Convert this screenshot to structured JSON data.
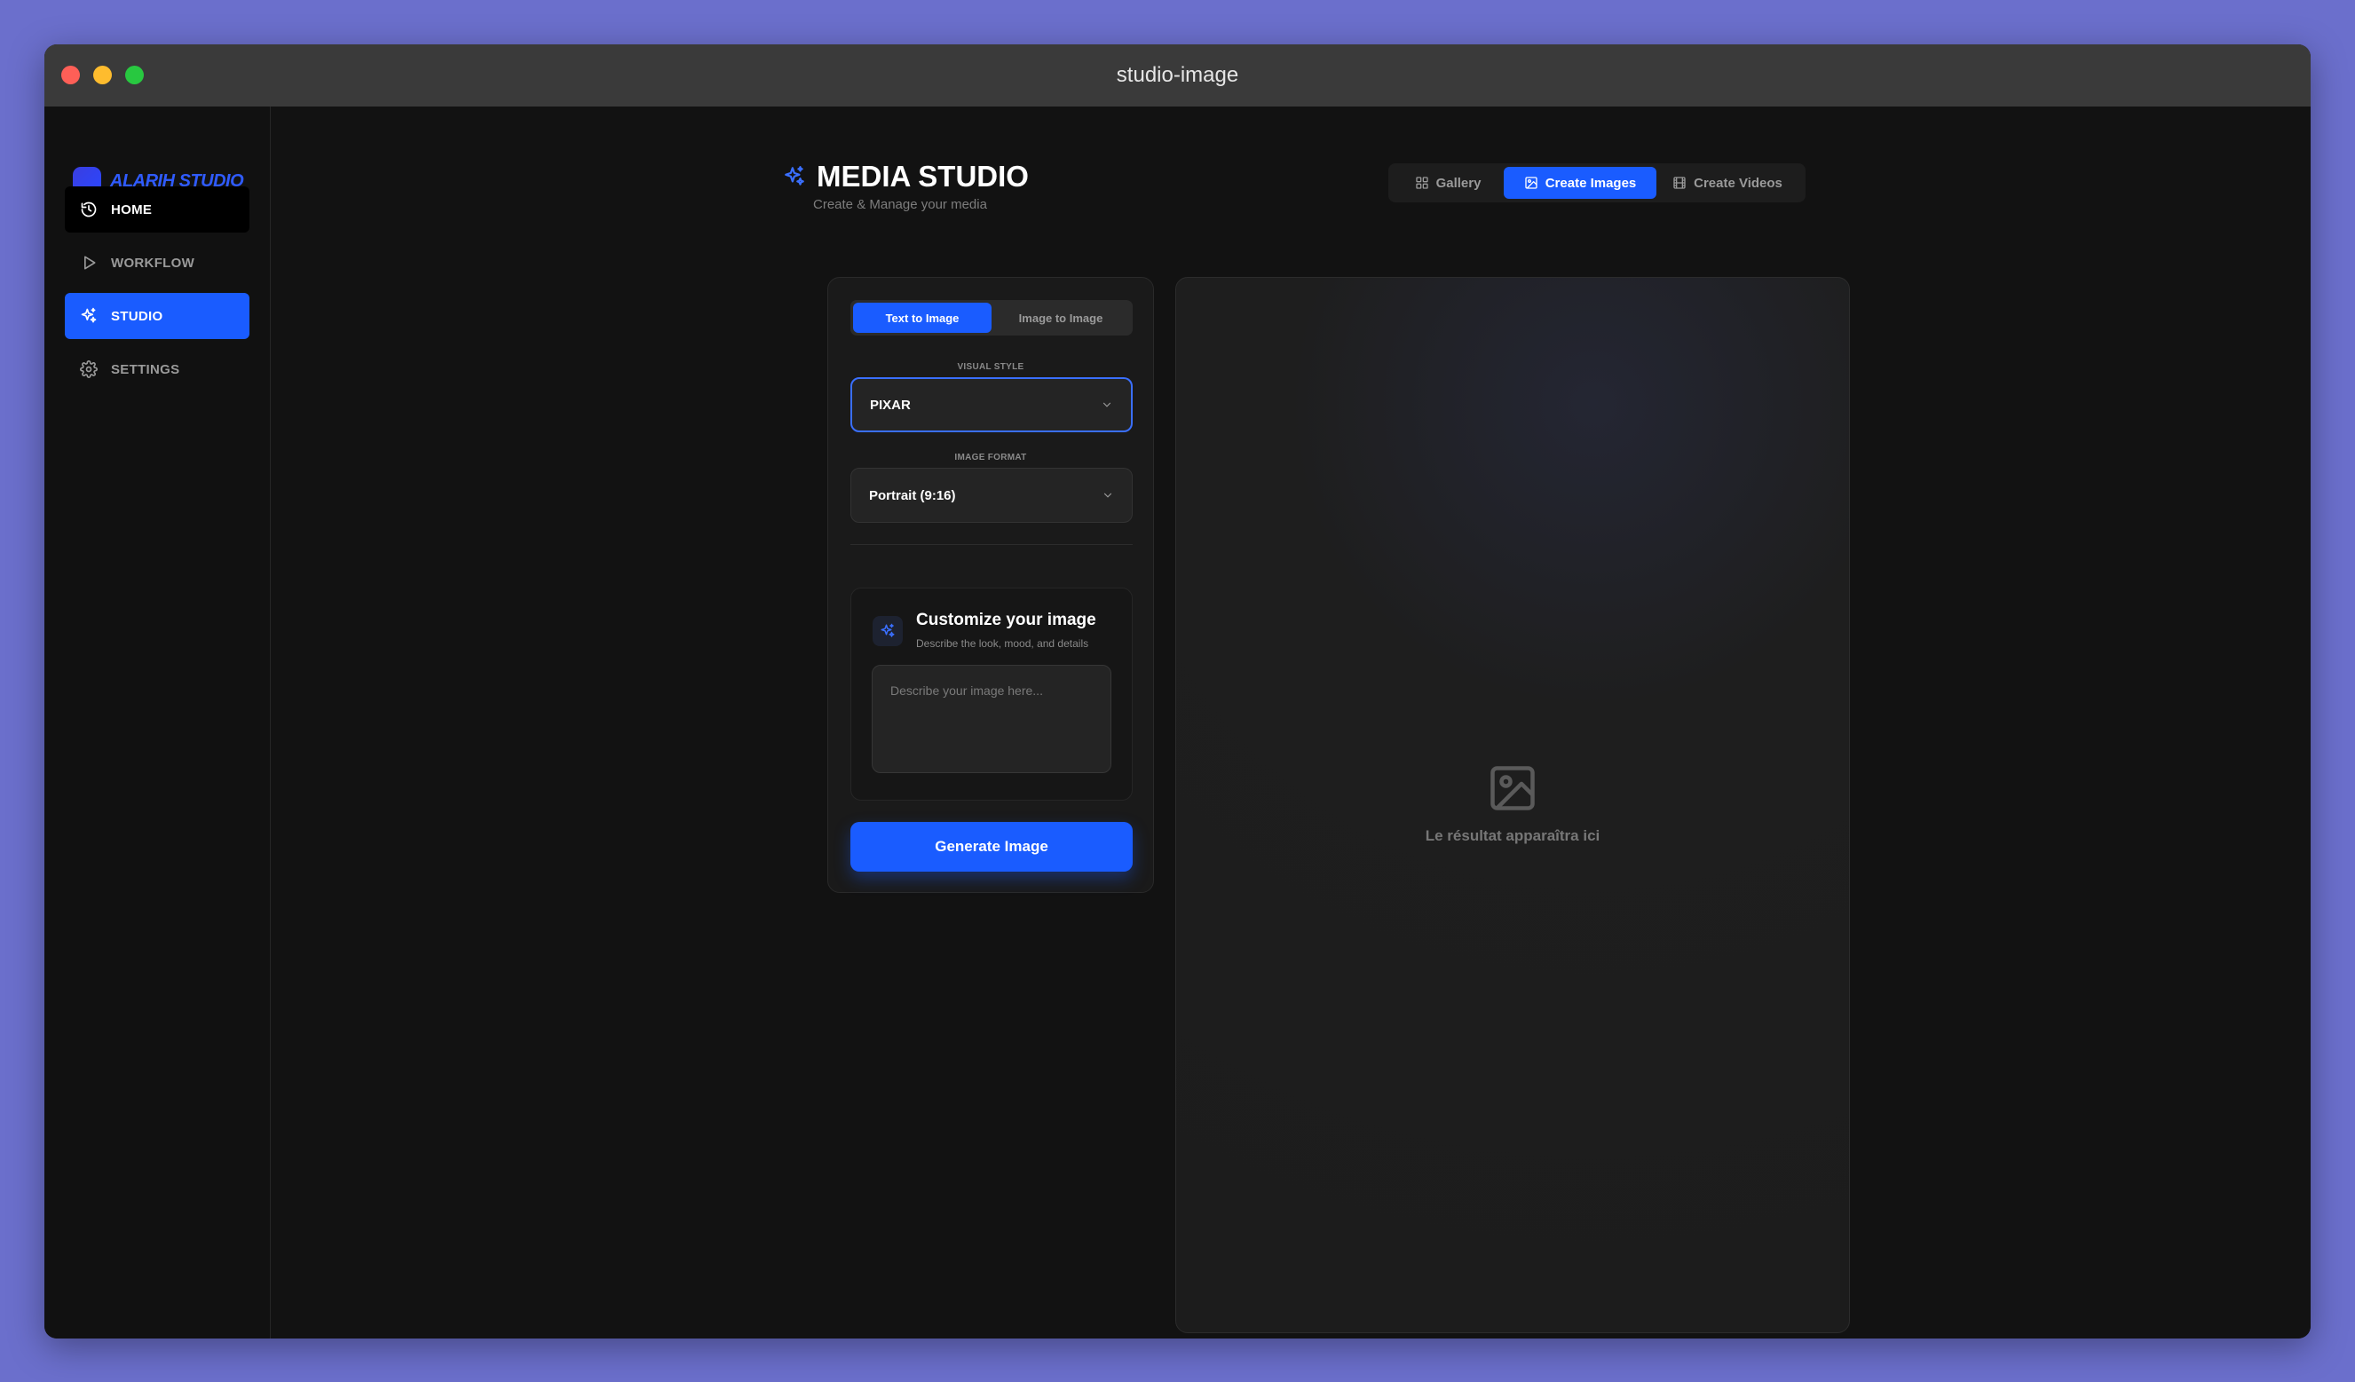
{
  "window": {
    "title": "studio-image"
  },
  "sidebar": {
    "brand": "ALARIH STUDIO",
    "items": [
      {
        "label": "HOME",
        "icon": "history-icon"
      },
      {
        "label": "WORKFLOW",
        "icon": "play-icon"
      },
      {
        "label": "STUDIO",
        "icon": "sparkles-icon"
      },
      {
        "label": "SETTINGS",
        "icon": "gear-icon"
      }
    ]
  },
  "header": {
    "title": "MEDIA STUDIO",
    "subtitle": "Create & Manage your media"
  },
  "top_tabs": [
    {
      "label": "Gallery",
      "icon": "grid-icon"
    },
    {
      "label": "Create Images",
      "icon": "image-icon",
      "active": true
    },
    {
      "label": "Create Videos",
      "icon": "film-icon"
    }
  ],
  "mode_tabs": [
    {
      "label": "Text to Image",
      "active": true
    },
    {
      "label": "Image to Image"
    }
  ],
  "visual_style": {
    "label": "VISUAL STYLE",
    "value": "PIXAR"
  },
  "image_format": {
    "label": "IMAGE FORMAT",
    "value": "Portrait (9:16)"
  },
  "customize": {
    "title": "Customize your image",
    "subtitle": "Describe the look, mood, and details",
    "placeholder": "Describe your image here..."
  },
  "generate_label": "Generate Image",
  "result": {
    "empty_text": "Le résultat apparaîtra ici"
  },
  "colors": {
    "accent": "#1a5cff",
    "background": "#121212",
    "panel": "#1a1a1a"
  }
}
